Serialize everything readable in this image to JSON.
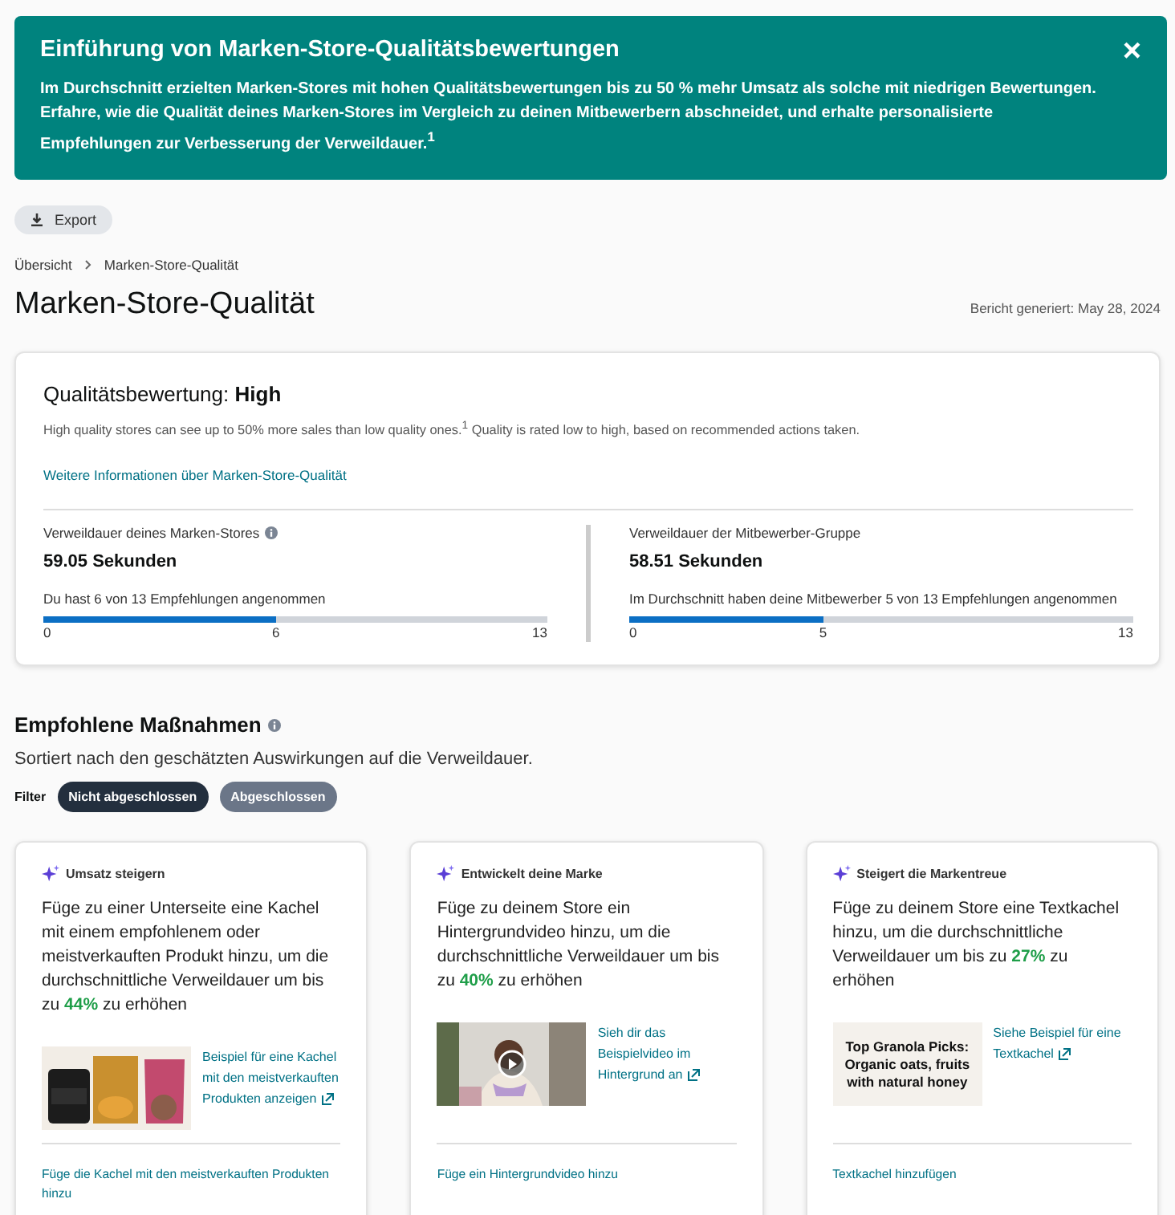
{
  "banner": {
    "title": "Einführung von Marken-Store-Qualitätsbewertungen",
    "text": "Im Durchschnitt erzielten Marken-Stores mit hohen Qualitätsbewertungen bis zu 50 % mehr Umsatz als solche mit niedrigen Bewertungen. Erfahre, wie die Qualität deines Marken-Stores im Vergleich zu deinen Mitbewerbern abschneidet, und erhalte personalisierte Empfehlungen zur Verbesserung der Verweildauer.$^{1}$",
    "close": "×"
  },
  "export_button": "Export",
  "breadcrumb": [
    "Übersicht",
    "Marken-Store-Qualität"
  ],
  "page_title": "Marken-Store-Qualität",
  "report_date": "Bericht generiert: May 28, 2024",
  "quality": {
    "label": "Qualitätsbewertung:",
    "rating": "High",
    "description": "High quality stores can see up to 50% more sales than low quality ones.$^{1}$ Quality is rated low to high, based on recommended actions taken.",
    "link": "Weitere Informationen über Marken-Store-Qualität",
    "metrics": [
      {
        "title": "Verweildauer deines Marken-Stores",
        "info": true,
        "value": "59.05 Sekunden",
        "caption": "Du hast 6 von 13 Empfehlungen angenommen",
        "level": 0.4615,
        "ticks": [
          "0",
          "6",
          "13"
        ]
      },
      {
        "title": "Verweildauer der Mitbewerber-Gruppe",
        "info": false,
        "value": "58.51 Sekunden",
        "caption": "Im Durchschnitt haben deine Mitbewerber 5 von 13 Empfehlungen angenommen",
        "level": 0.3846,
        "ticks": [
          "0",
          "5",
          "13"
        ]
      }
    ]
  },
  "actions": {
    "title": "Empfohlene Maßnahmen",
    "subtitle": "Sortiert nach den geschätzten Auswirkungen auf die Verweildauer.",
    "filter_label": "Filter",
    "filters": [
      {
        "label": "Nicht abgeschlossen",
        "selected": true
      },
      {
        "label": "Abgeschlossen",
        "selected": false
      }
    ],
    "cards": [
      {
        "category": "Umsatz steigern",
        "text": "Füge zu einer Unterseite eine Kachel mit einem empfohlenem oder meistverkauften Produkt hinzu, um die durchschnittliche Verweildauer um bis zu",
        "highlight": "44%",
        "text_end": "zu erhöhen",
        "media": {
          "kind": "products"
        },
        "example_link": "Beispiel für eine Kachel mit den meistverkauften Produkten anzeigen",
        "action": "Füge die Kachel mit den meistverkauften Produkten hinzu"
      },
      {
        "category": "Entwickelt deine Marke",
        "text": "Füge zu deinem Store ein Hintergrundvideo hinzu, um die durchschnittliche Verweildauer um bis zu",
        "highlight": "40%",
        "text_end": "zu erhöhen",
        "media": {
          "kind": "video"
        },
        "example_link": "Sieh dir das Beispielvideo im Hintergrund an",
        "action": "Füge ein Hintergrundvideo hinzu"
      },
      {
        "category": "Steigert die Markentreue",
        "text": "Füge zu deinem Store eine Textkachel hinzu, um die durchschnittliche Verweildauer um bis zu",
        "highlight": "27%",
        "text_end": "zu erhöhen",
        "media": {
          "kind": "text_tile",
          "text": "Top Granola Picks: Organic oats, fruits with natural honey"
        },
        "example_link": "Siehe Beispiel für eine Textkachel",
        "action": "Textkachel hinzufügen"
      }
    ]
  }
}
